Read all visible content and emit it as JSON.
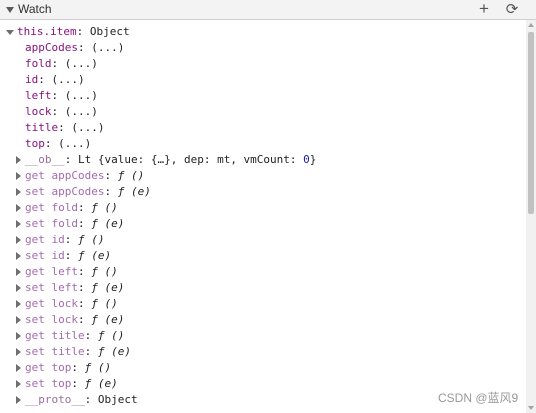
{
  "panel": {
    "title": "Watch",
    "add_icon": "plus-icon",
    "refresh_icon": "refresh-icon"
  },
  "root": {
    "name": "this.item",
    "sep": ": ",
    "value": "Object"
  },
  "props": [
    {
      "name": "appCodes",
      "value": ": (...)"
    },
    {
      "name": "fold",
      "value": ": (...)"
    },
    {
      "name": "id",
      "value": ": (...)"
    },
    {
      "name": "left",
      "value": ": (...)"
    },
    {
      "name": "lock",
      "value": ": (...)"
    },
    {
      "name": "title",
      "value": ": (...)"
    },
    {
      "name": "top",
      "value": ": (...)"
    }
  ],
  "ob": {
    "name": "__ob__",
    "pre": ": Lt {value: {…}, dep: mt, vmCount: ",
    "count": "0",
    "post": "}"
  },
  "accessors": [
    {
      "name": "get appCodes",
      "sep": ": ",
      "fn": "ƒ ()"
    },
    {
      "name": "set appCodes",
      "sep": ": ",
      "fn": "ƒ (e)"
    },
    {
      "name": "get fold",
      "sep": ": ",
      "fn": "ƒ ()"
    },
    {
      "name": "set fold",
      "sep": ": ",
      "fn": "ƒ (e)"
    },
    {
      "name": "get id",
      "sep": ": ",
      "fn": "ƒ ()"
    },
    {
      "name": "set id",
      "sep": ": ",
      "fn": "ƒ (e)"
    },
    {
      "name": "get left",
      "sep": ": ",
      "fn": "ƒ ()"
    },
    {
      "name": "set left",
      "sep": ": ",
      "fn": "ƒ (e)"
    },
    {
      "name": "get lock",
      "sep": ": ",
      "fn": "ƒ ()"
    },
    {
      "name": "set lock",
      "sep": ": ",
      "fn": "ƒ (e)"
    },
    {
      "name": "get title",
      "sep": ": ",
      "fn": "ƒ ()"
    },
    {
      "name": "set title",
      "sep": ": ",
      "fn": "ƒ (e)"
    },
    {
      "name": "get top",
      "sep": ": ",
      "fn": "ƒ ()"
    },
    {
      "name": "set top",
      "sep": ": ",
      "fn": "ƒ (e)"
    }
  ],
  "proto": {
    "name": "__proto__",
    "value": ": Object"
  },
  "watermark": "CSDN @蓝风9",
  "colors": {
    "key": "#881280",
    "accessor_key": "#a46ab0",
    "number": "#1a1aa6",
    "header_bg": "#f3f3f3"
  }
}
